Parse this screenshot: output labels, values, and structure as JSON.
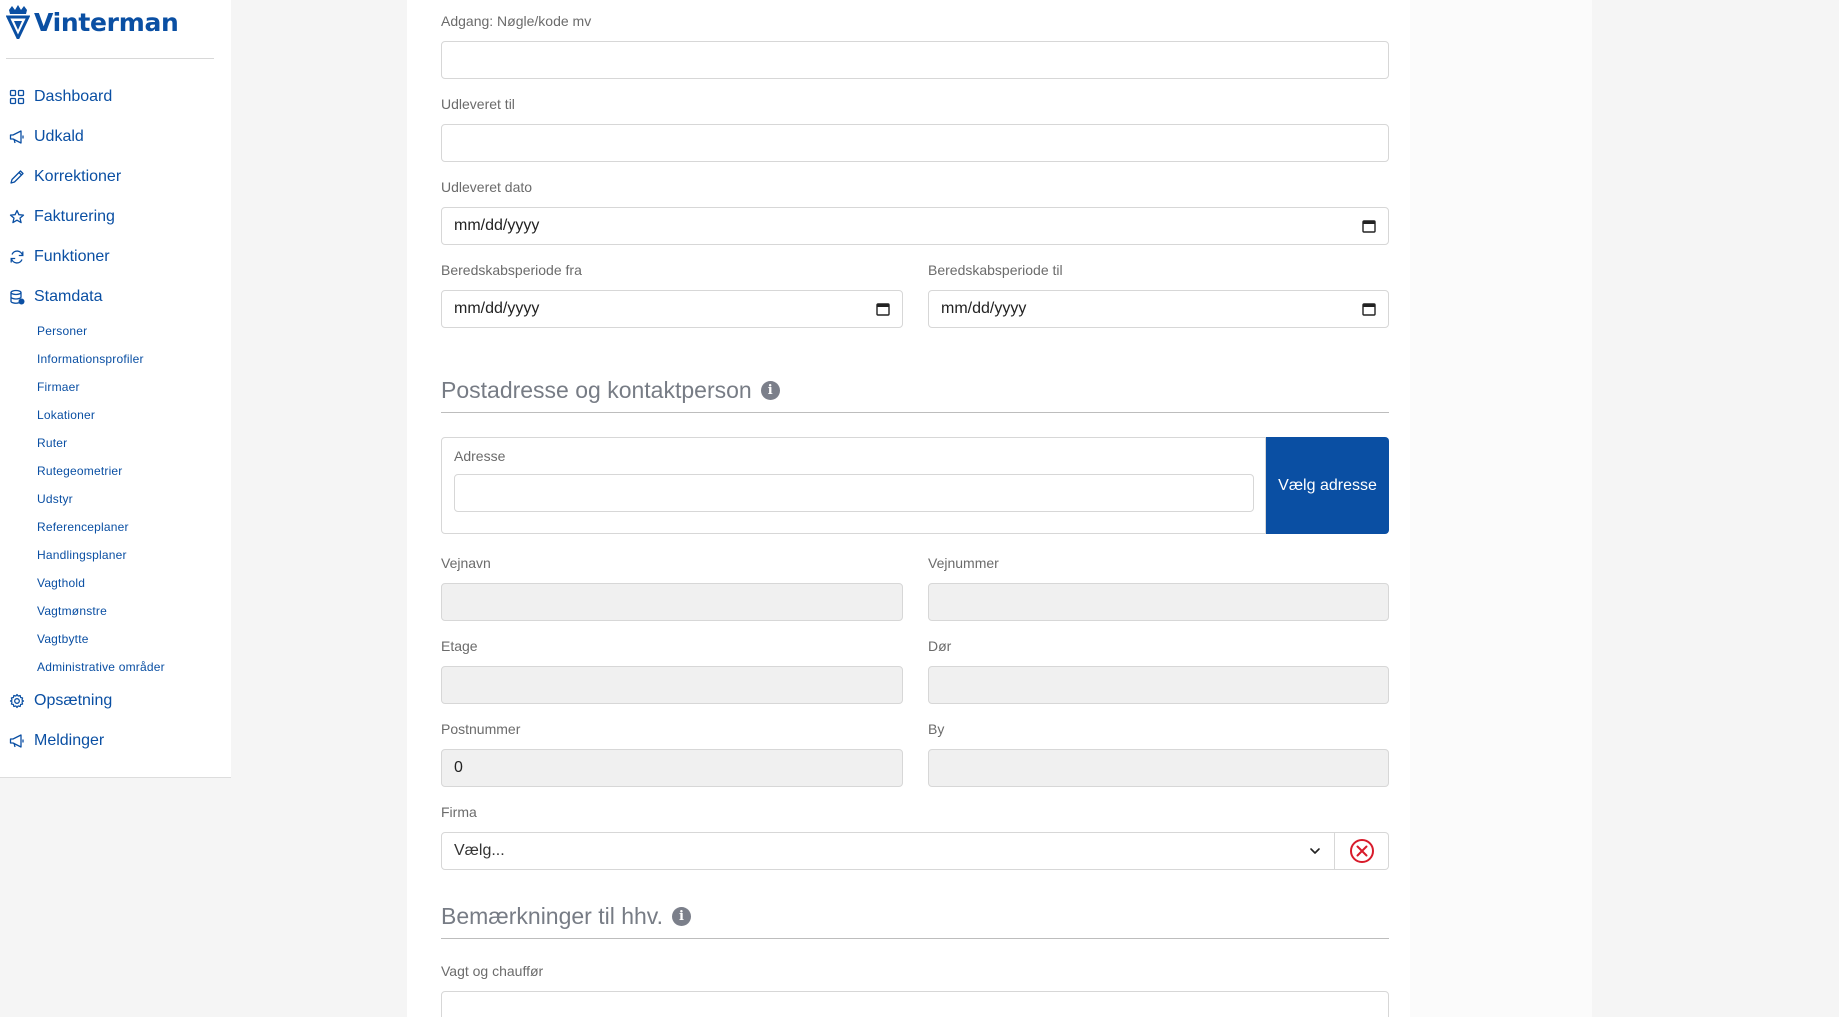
{
  "app": {
    "brand": "Vinterman"
  },
  "sidebar": {
    "items": [
      {
        "label": "Dashboard",
        "icon": "dashboard-icon"
      },
      {
        "label": "Udkald",
        "icon": "megaphone-icon"
      },
      {
        "label": "Korrektioner",
        "icon": "pencil-icon"
      },
      {
        "label": "Fakturering",
        "icon": "star-icon"
      },
      {
        "label": "Funktioner",
        "icon": "refresh-icon"
      },
      {
        "label": "Stamdata",
        "icon": "database-icon"
      }
    ],
    "stamdata_sub": [
      "Personer",
      "Informationsprofiler",
      "Firmaer",
      "Lokationer",
      "Ruter",
      "Rutegeometrier",
      "Udstyr",
      "Referenceplaner",
      "Handlingsplaner",
      "Vagthold",
      "Vagtmønstre",
      "Vagtbytte",
      "Administrative områder"
    ],
    "bottom_items": [
      {
        "label": "Opsætning",
        "icon": "gear-icon"
      },
      {
        "label": "Meldinger",
        "icon": "megaphone-icon"
      }
    ]
  },
  "form": {
    "adgang": {
      "label": "Adgang: Nøgle/kode mv",
      "value": ""
    },
    "udleveret_til": {
      "label": "Udleveret til",
      "value": ""
    },
    "udleveret_dato": {
      "label": "Udleveret dato",
      "value": "mm/dd/yyyy"
    },
    "beredskab_fra": {
      "label": "Beredskabsperiode fra",
      "value": "mm/dd/yyyy"
    },
    "beredskab_til": {
      "label": "Beredskabsperiode til",
      "value": "mm/dd/yyyy"
    },
    "section_post": "Postadresse og kontaktperson",
    "adresse": {
      "label": "Adresse",
      "value": "",
      "button": "Vælg adresse"
    },
    "vejnavn": {
      "label": "Vejnavn",
      "value": ""
    },
    "vejnummer": {
      "label": "Vejnummer",
      "value": ""
    },
    "etage": {
      "label": "Etage",
      "value": ""
    },
    "dor": {
      "label": "Dør",
      "value": ""
    },
    "postnummer": {
      "label": "Postnummer",
      "value": "0"
    },
    "by": {
      "label": "By",
      "value": ""
    },
    "firma": {
      "label": "Firma",
      "value": "Vælg..."
    },
    "section_bemaerk": "Bemærkninger til hhv.",
    "vagt_chauffor": {
      "label": "Vagt og chauffør",
      "value": ""
    }
  },
  "colors": {
    "brand": "#0a4fa3",
    "danger": "#d81b2b"
  }
}
